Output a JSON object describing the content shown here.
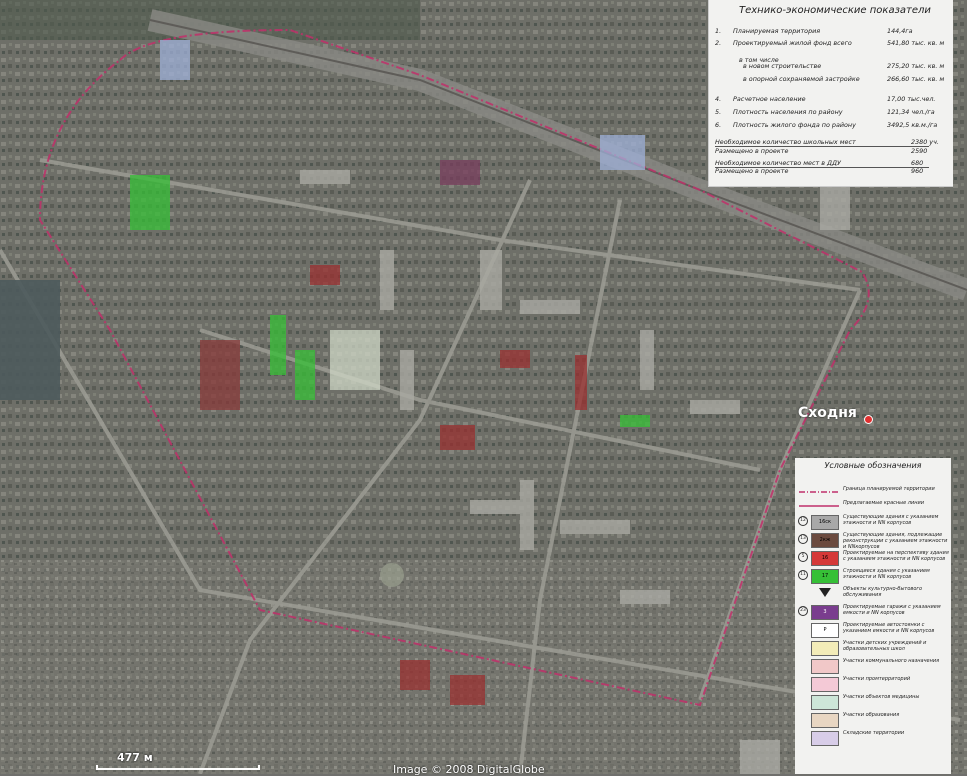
{
  "map": {
    "place_label": "Сходня",
    "scale_label": "477 м",
    "copyright": "Image © 2008 DigitalGlobe"
  },
  "indicators": {
    "title": "Технико-экономические показатели",
    "rows": [
      {
        "n": "1.",
        "label": "Планируемая территория",
        "value": "144,4га"
      },
      {
        "n": "2.",
        "label": "Проектируемый жилой фонд всего",
        "value": "541,80 тыс. кв. м"
      },
      {
        "n": "",
        "label": "в том числе",
        "value": ""
      },
      {
        "n": "",
        "label": "в новом строительстве",
        "value": "275,20 тыс. кв. м"
      },
      {
        "n": "",
        "label": "в опорной сохраняемой застройке",
        "value": "266,60 тыс. кв. м"
      },
      {
        "n": "4.",
        "label": "Расчетное население",
        "value": "17,00 тыс.чел."
      },
      {
        "n": "5.",
        "label": "Плотность населения по району",
        "value": "121,34 чел./га"
      },
      {
        "n": "6.",
        "label": "Плотность жилого фонда по району",
        "value": "3492,5 кв.м./га"
      },
      {
        "n": "",
        "label": "Необходимое количество школьных мест",
        "value": "2380 уч."
      },
      {
        "n": "",
        "label": "Размещено в проекте",
        "value": "2590"
      },
      {
        "n": "",
        "label": "Необходимое количество мест в ДДУ",
        "value": "680"
      },
      {
        "n": "",
        "label": "Размещено в проекте",
        "value": "960"
      }
    ]
  },
  "legend": {
    "title": "Условные обозначения",
    "items": [
      {
        "type": "line",
        "text": "Граница планируемой территории",
        "color": "#c0306a",
        "dash": "6,2,1,2"
      },
      {
        "type": "line",
        "text": "Предлагаемые красные линии",
        "color": "#c0306a",
        "dash": ""
      },
      {
        "type": "swatch",
        "badge": "12",
        "sw": "16ск",
        "text": "Существующие здания с указанием этажности и NN корпусов",
        "fill": "#a8a8a8",
        "tc": "#000"
      },
      {
        "type": "swatch",
        "badge": "13",
        "sw": "2кж",
        "text": "Существующие здания, подлежащие реконструкции с указанием этажности и NNкорпусов",
        "fill": "#6b4a3e",
        "tc": "#000"
      },
      {
        "type": "swatch",
        "badge": "5",
        "sw": "16",
        "text": "Проектируемые на перспективу здания с указанием этажности и NN корпусов",
        "fill": "#d53838",
        "tc": "#000"
      },
      {
        "type": "swatch",
        "badge": "11",
        "sw": "17",
        "text": "Строящиеся здания с указанием этажности и NN корпусов",
        "fill": "#36c036",
        "tc": "#000"
      },
      {
        "type": "tri",
        "text": "Объекты культурно-бытового обслуживания"
      },
      {
        "type": "swatch",
        "badge": "23",
        "sw": "3",
        "text": "Проектируемые гаражи с указанием емкости и NN корпусов",
        "fill": "#7a3d8e",
        "tc": "#fff"
      },
      {
        "type": "swatch",
        "badge": "",
        "sw": "P",
        "text": "Проектируемые автостоянки с указанием емкости и NN корпусов",
        "fill": "#ffffff",
        "tc": "#000"
      },
      {
        "type": "swatch",
        "badge": "",
        "sw": "",
        "text": "Участки детских учреждений и образовательных школ",
        "fill": "#f3ecb8",
        "tc": "#000"
      },
      {
        "type": "swatch",
        "badge": "",
        "sw": "",
        "text": "Участки коммунального назначения",
        "fill": "#f1c8c8",
        "tc": "#000"
      },
      {
        "type": "swatch",
        "badge": "",
        "sw": "",
        "text": "Участки промтерриторий",
        "fill": "#f4c9d6",
        "tc": "#000"
      },
      {
        "type": "swatch",
        "badge": "",
        "sw": "",
        "text": "Участки объектов медицины",
        "fill": "#cde6d8",
        "tc": "#000"
      },
      {
        "type": "swatch",
        "badge": "",
        "sw": "",
        "text": "Участки образования",
        "fill": "#e8d6c2",
        "tc": "#000"
      },
      {
        "type": "swatch",
        "badge": "",
        "sw": "",
        "text": "Складские территории",
        "fill": "#d8cde8",
        "tc": "#000"
      }
    ]
  }
}
